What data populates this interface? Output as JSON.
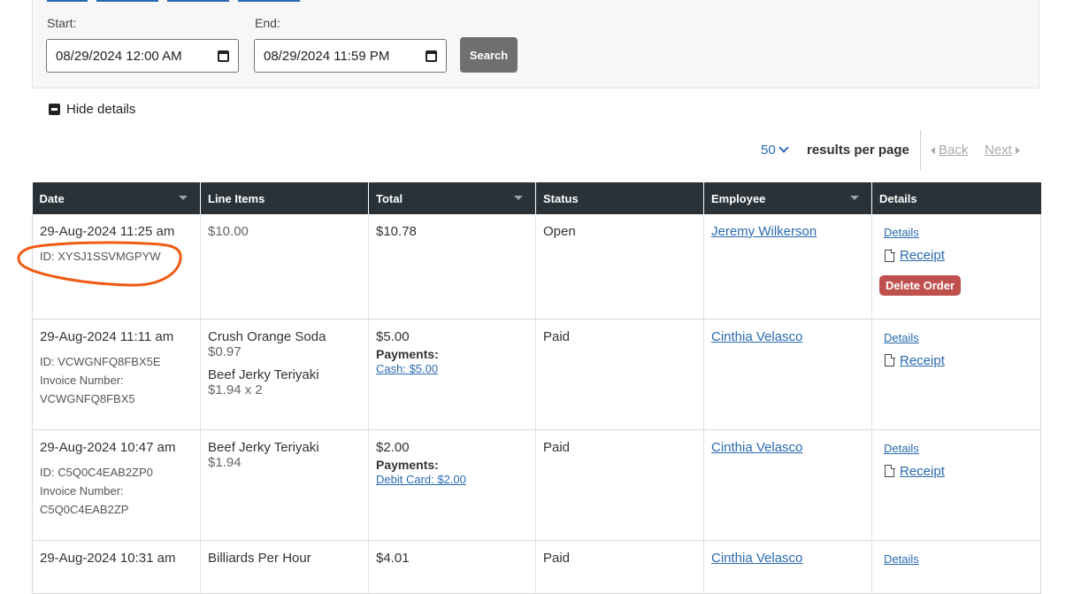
{
  "filter": {
    "start_label": "Start:",
    "start_value": "08/29/2024 12:00  AM",
    "end_label": "End:",
    "end_value": "08/29/2024 11:59  PM",
    "search_label": "Search"
  },
  "hide_details_label": "Hide details",
  "pagination": {
    "per_page_value": "50",
    "per_page_label": "results per page",
    "back_label": "Back",
    "next_label": "Next"
  },
  "table": {
    "headers": [
      "Date",
      "Line Items",
      "Total",
      "Status",
      "Employee",
      "Details"
    ],
    "details_label": "Details",
    "receipt_label": "Receipt",
    "delete_label": "Delete Order",
    "payments_label": "Payments:",
    "rows": [
      {
        "date": "29-Aug-2024 11:25 am",
        "id": "ID: XYSJ1SSVMGPYW",
        "line_items": [
          {
            "name": "$10.00"
          }
        ],
        "total": "$10.78",
        "status": "Open",
        "employee": "Jeremy Wilkerson"
      },
      {
        "date": "29-Aug-2024 11:11 am",
        "id": "ID: VCWGNFQ8FBX5E",
        "invoice_label": "Invoice Number:",
        "invoice": "VCWGNFQ8FBX5",
        "line_items": [
          {
            "name": "Crush Orange Soda",
            "price": "$0.97"
          },
          {
            "name": "Beef Jerky Teriyaki",
            "price": "$1.94 x 2"
          }
        ],
        "total": "$5.00",
        "payment": "Cash: $5.00",
        "status": "Paid",
        "employee": "Cinthia Velasco"
      },
      {
        "date": "29-Aug-2024 10:47 am",
        "id": "ID: C5Q0C4EAB2ZP0",
        "invoice_label": "Invoice Number:",
        "invoice": "C5Q0C4EAB2ZP",
        "line_items": [
          {
            "name": "Beef Jerky Teriyaki",
            "price": "$1.94"
          }
        ],
        "total": "$2.00",
        "payment": "Debit Card: $2.00",
        "status": "Paid",
        "employee": "Cinthia Velasco"
      },
      {
        "date": "29-Aug-2024 10:31 am",
        "line_items": [
          {
            "name": "Billiards Per Hour"
          }
        ],
        "total": "$4.01",
        "status": "Paid",
        "employee": "Cinthia Velasco"
      }
    ]
  },
  "colors": {
    "header_bg": "#293238",
    "link": "#2a6ab0",
    "delete_button": "#c0504d",
    "annotation": "#f05a14"
  }
}
